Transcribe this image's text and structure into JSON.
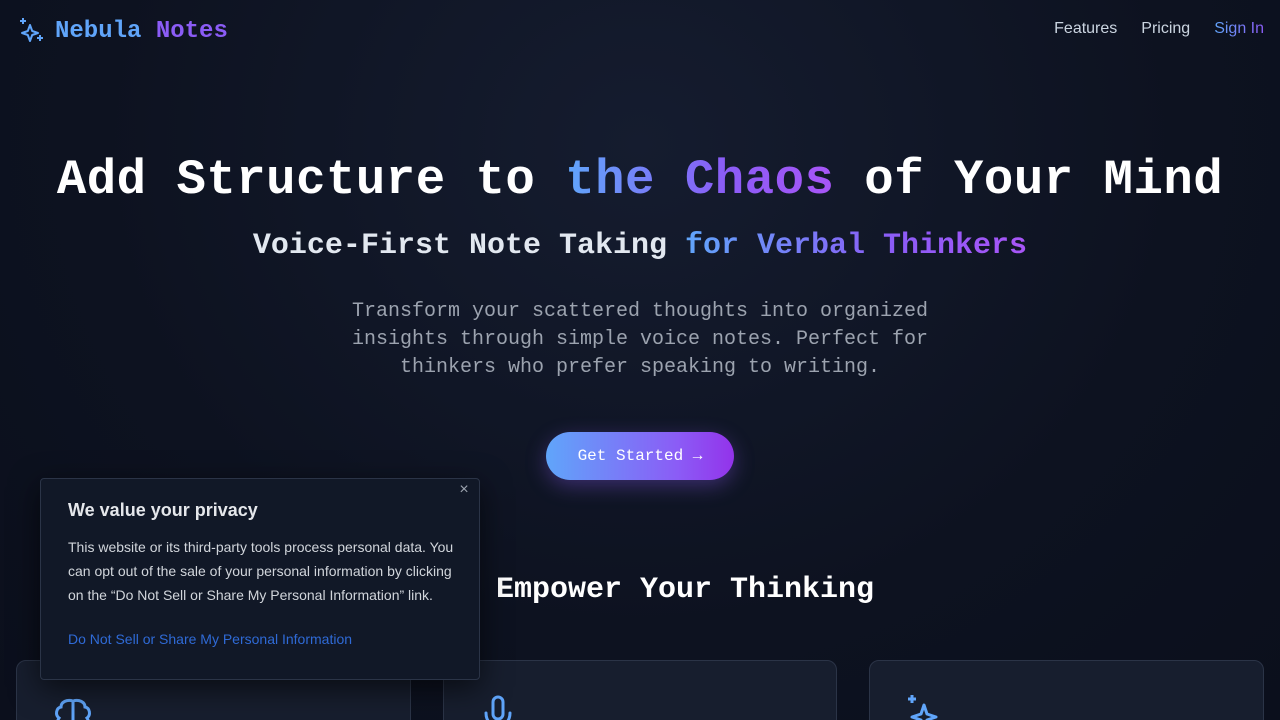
{
  "brand": {
    "word1": "Nebula",
    "word2": "Notes"
  },
  "nav": {
    "features": "Features",
    "pricing": "Pricing",
    "signin": "Sign In"
  },
  "hero": {
    "title_part1": "Add Structure to ",
    "title_highlight": "the Chaos",
    "title_part2": " of Your Mind",
    "subtitle_part1": "Voice-First Note Taking ",
    "subtitle_highlight": "for Verbal Thinkers",
    "description": "Transform your scattered thoughts into organized insights through simple voice notes. Perfect for thinkers who prefer speaking to writing.",
    "cta_label": "Get Started →"
  },
  "features": {
    "title": "that Empower Your Thinking"
  },
  "privacy": {
    "title": "We value your privacy",
    "body": "This website or its third-party tools process personal data. You can opt out of the sale of your personal information by clicking on the “Do Not Sell or Share My Personal Information” link.",
    "link": "Do Not Sell or Share My Personal Information",
    "close_icon": "close-icon"
  },
  "colors": {
    "accent_blue": "#60a5fa",
    "accent_purple": "#8b5cf6",
    "background": "#0d1220"
  },
  "icons": {
    "logo": "sparkles-icon",
    "card1": "brain-icon",
    "card2": "microphone-icon",
    "card3": "sparkles-icon"
  }
}
